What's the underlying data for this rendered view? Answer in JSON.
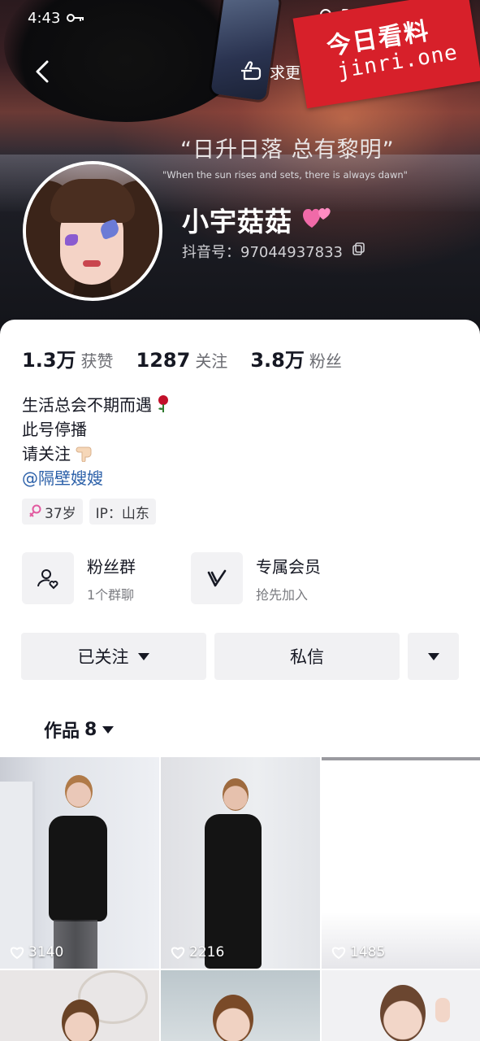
{
  "status_bar": {
    "time": "4:43"
  },
  "header": {
    "search_label": "求更",
    "quote_cn": "“日升日落 总有黎明”",
    "quote_en": "\"When the sun rises and sets, there is always dawn\"",
    "nickname": "小宇菇菇",
    "douyin_id_label": "抖音号：",
    "douyin_id": "97044937833"
  },
  "watermark": {
    "line1": "今日看料",
    "line2": "jinri.one"
  },
  "stats": [
    {
      "value": "1.3万",
      "label": "获赞"
    },
    {
      "value": "1287",
      "label": "关注"
    },
    {
      "value": "3.8万",
      "label": "粉丝"
    }
  ],
  "bio": {
    "line1": "生活总会不期而遇",
    "line2": "此号停播",
    "line3": "请关注",
    "mention": "@隔壁嫂嫂"
  },
  "tags": {
    "age": "37岁",
    "ip": "IP：山东"
  },
  "features": [
    {
      "title": "粉丝群",
      "subtitle": "1个群聊",
      "icon": "fans-group-icon"
    },
    {
      "title": "专属会员",
      "subtitle": "抢先加入",
      "icon": "vip-icon"
    }
  ],
  "actions": {
    "following": "已关注",
    "message": "私信"
  },
  "works_tab": {
    "label": "作品",
    "count": "8"
  },
  "videos": [
    {
      "likes": "3140"
    },
    {
      "likes": "2216"
    },
    {
      "likes": "1485"
    }
  ],
  "colors": {
    "accent_link": "#2a5fa8",
    "watermark": "#d7202a"
  }
}
